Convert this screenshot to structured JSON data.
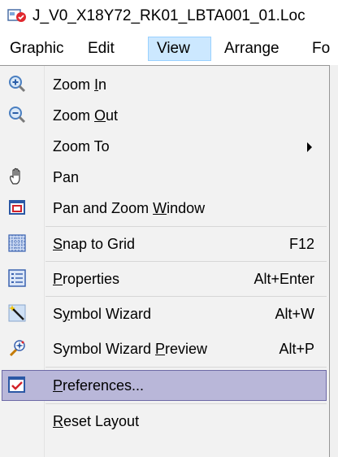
{
  "window": {
    "title": "J_V0_X18Y72_RK01_LBTA001_01.Loc"
  },
  "menubar": {
    "items": [
      {
        "label": "Graphic"
      },
      {
        "label": "Edit"
      },
      {
        "label": "View"
      },
      {
        "label": "Arrange"
      },
      {
        "label": "Fo"
      }
    ],
    "open_item": "View"
  },
  "view_menu": {
    "items": [
      {
        "id": "zoom-in",
        "pre": "Zoom ",
        "mnemonic": "I",
        "post": "n",
        "shortcut": "",
        "icon": "zoom-in-icon",
        "submenu": false
      },
      {
        "id": "zoom-out",
        "pre": "Zoom ",
        "mnemonic": "O",
        "post": "ut",
        "shortcut": "",
        "icon": "zoom-out-icon",
        "submenu": false
      },
      {
        "id": "zoom-to",
        "pre": "Zoom To",
        "mnemonic": "",
        "post": "",
        "shortcut": "",
        "icon": "",
        "submenu": true
      },
      {
        "id": "pan",
        "pre": "Pan",
        "mnemonic": "",
        "post": "",
        "shortcut": "",
        "icon": "hand-icon",
        "submenu": false
      },
      {
        "id": "pan-zoom-window",
        "pre": "Pan and Zoom ",
        "mnemonic": "W",
        "post": "indow",
        "shortcut": "",
        "icon": "window-icon",
        "submenu": false
      },
      {
        "id": "snap-to-grid",
        "pre": "",
        "mnemonic": "S",
        "post": "nap to Grid",
        "shortcut": "F12",
        "icon": "grid-icon",
        "submenu": false
      },
      {
        "id": "properties",
        "pre": "",
        "mnemonic": "P",
        "post": "roperties",
        "shortcut": "Alt+Enter",
        "icon": "properties-icon",
        "submenu": false
      },
      {
        "id": "symbol-wizard",
        "pre": "S",
        "mnemonic": "y",
        "post": "mbol Wizard",
        "shortcut": "Alt+W",
        "icon": "wand-icon",
        "submenu": false
      },
      {
        "id": "symbol-wizard-preview",
        "pre": "Symbol Wizard ",
        "mnemonic": "P",
        "post": "review",
        "shortcut": "Alt+P",
        "icon": "wizard-preview-icon",
        "submenu": false
      },
      {
        "id": "preferences",
        "pre": "",
        "mnemonic": "P",
        "post": "references...",
        "shortcut": "",
        "icon": "checkbox-icon",
        "submenu": false,
        "highlighted": true
      },
      {
        "id": "reset-layout",
        "pre": "",
        "mnemonic": "R",
        "post": "eset Layout",
        "shortcut": "",
        "icon": "",
        "submenu": false
      }
    ]
  },
  "colors": {
    "menu_open_bg": "#cce8ff",
    "menu_bg": "#f2f2f2",
    "highlight_bg": "#b9b7d9",
    "highlight_border": "#6e6aa6"
  }
}
